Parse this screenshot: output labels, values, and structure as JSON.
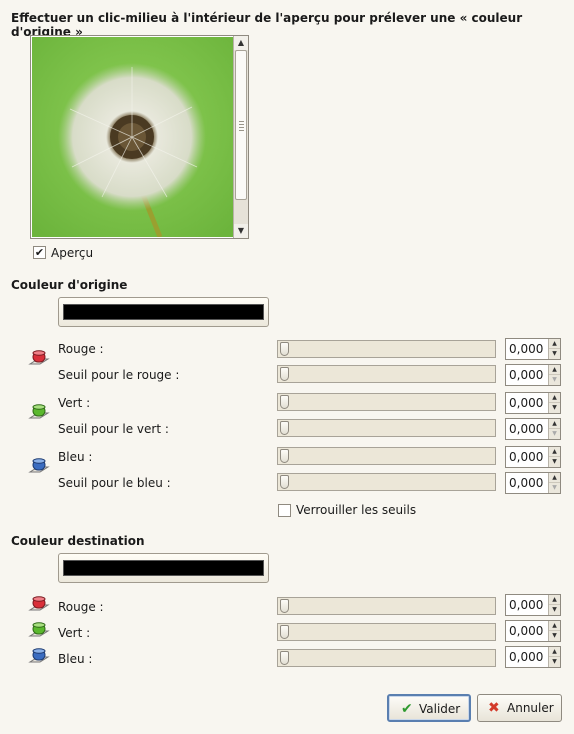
{
  "instruction": "Effectuer un clic-milieu à l'intérieur de l'aperçu pour prélever une « couleur d'origine »",
  "preview": {
    "checkbox_label": "Aperçu",
    "checked": true
  },
  "source": {
    "title": "Couleur d'origine",
    "swatch_color": "#000000",
    "rows": [
      {
        "label": "Rouge :",
        "value": "0,000"
      },
      {
        "label": "Seuil pour le rouge :",
        "value": "0,000"
      },
      {
        "label": "Vert :",
        "value": "0,000"
      },
      {
        "label": "Seuil pour le vert :",
        "value": "0,000"
      },
      {
        "label": "Bleu :",
        "value": "0,000"
      },
      {
        "label": "Seuil pour le bleu :",
        "value": "0,000"
      }
    ],
    "lock_label": "Verrouiller les seuils",
    "lock_checked": false
  },
  "destination": {
    "title": "Couleur destination",
    "swatch_color": "#000000",
    "rows": [
      {
        "label": "Rouge :",
        "value": "0,000"
      },
      {
        "label": "Vert :",
        "value": "0,000"
      },
      {
        "label": "Bleu :",
        "value": "0,000"
      }
    ]
  },
  "buttons": {
    "ok": "Valider",
    "cancel": "Annuler"
  },
  "colors": {
    "red_channel": "#d9303a",
    "green_channel": "#5bb82e",
    "blue_channel": "#3a6cc0",
    "ok_check": "#2f9a2f",
    "cancel_x": "#d33a2a"
  }
}
